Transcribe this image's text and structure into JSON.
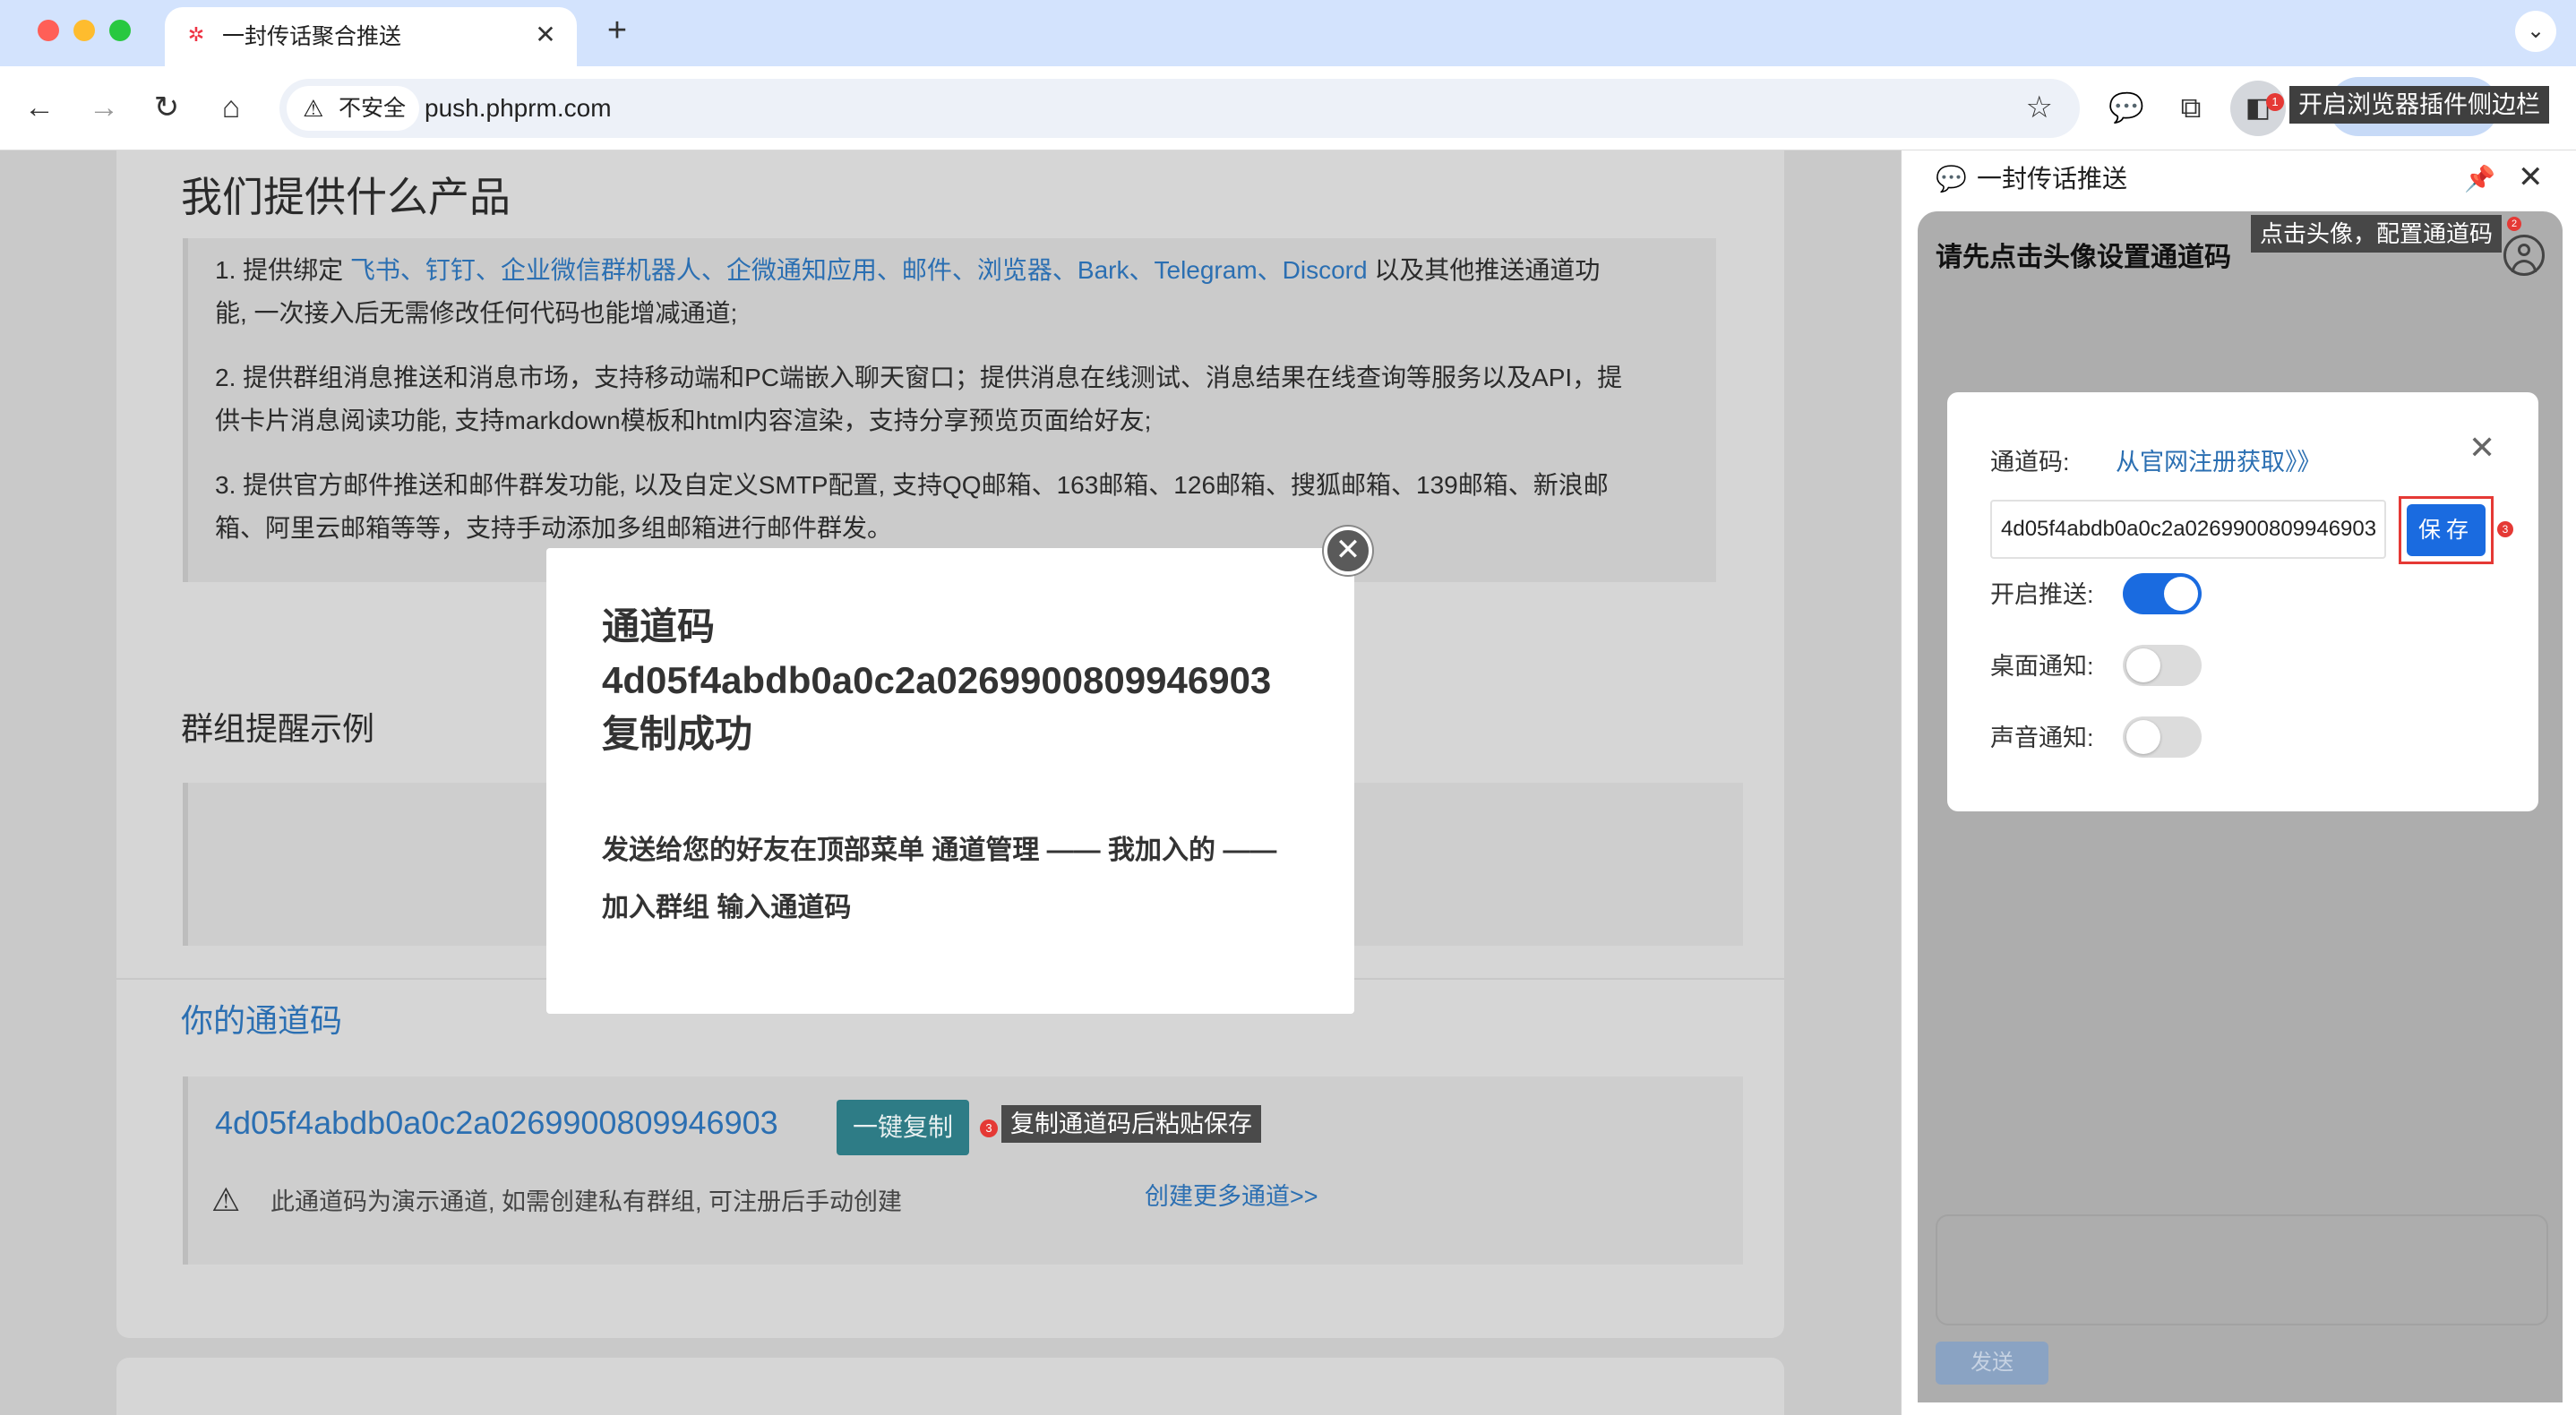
{
  "browser": {
    "tab_title": "一封传话聚合推送",
    "tab_close": "✕",
    "new_tab": "+",
    "security_label": "不安全",
    "url": "push.phprm.com",
    "sidebar_hint": "开启浏览器插件侧边栏",
    "sidebar_badge": "1",
    "icons": [
      "back-icon",
      "forward-icon",
      "reload-icon",
      "home-icon",
      "star-icon",
      "chat-icon",
      "extensions-icon",
      "sidebar-icon"
    ]
  },
  "page": {
    "products": {
      "heading": "我们提供什么产品",
      "p1_prefix": "1. 提供绑定 ",
      "p1_links": "飞书、钉钉、企业微信群机器人、企微通知应用、邮件、浏览器、Bark、Telegram、Discord",
      "p1_suffix": " 以及其他推送通道功能, 一次接入后无需修改任何代码也能增减通道;",
      "p2": "2. 提供群组消息推送和消息市场，支持移动端和PC端嵌入聊天窗口；提供消息在线测试、消息结果在线查询等服务以及API，提供卡片消息阅读功能, 支持markdown模板和html内容渲染，支持分享预览页面给好友;",
      "p3": "3. 提供官方邮件推送和邮件群发功能, 以及自定义SMTP配置, 支持QQ邮箱、163邮箱、126邮箱、搜狐邮箱、139邮箱、新浪邮箱、阿里云邮箱等等，支持手动添加多组邮箱进行邮件群发。"
    },
    "group_demo": {
      "heading": "群组提醒示例"
    },
    "channel": {
      "heading": "你的通道码",
      "code": "4d05f4abdb0a0c2a0269900809946903",
      "copy_button": "一键复制",
      "copy_badge": "3",
      "copy_hint": "复制通道码后粘贴保存",
      "warning": "此通道码为演示通道, 如需创建私有群组, 可注册后手动创建",
      "more_link": "创建更多通道>>"
    }
  },
  "modal": {
    "title_line1": "通道码",
    "title_line2": "4d05f4abdb0a0c2a0269900809946903",
    "title_line3": "复制成功",
    "body": "发送给您的好友在顶部菜单 通道管理 —— 我加入的 —— 加入群组 输入通道码",
    "close": "✕"
  },
  "sidepanel": {
    "title": "一封传话推送",
    "prompt": "请先点击头像设置通道码",
    "avatar_hint": "点击头像，配置通道码",
    "avatar_badge": "2",
    "send_button": "发送",
    "settings": {
      "channel_label": "通道码:",
      "register_link": "从官网注册获取》》",
      "channel_value": "4d05f4abdb0a0c2a0269900809946903",
      "save_button": "保存",
      "save_badge": "3",
      "enable_push_label": "开启推送:",
      "enable_push": true,
      "desktop_notify_label": "桌面通知:",
      "desktop_notify": false,
      "sound_notify_label": "声音通知:",
      "sound_notify": false
    }
  },
  "colors": {
    "accent": "#1a6be0",
    "link": "#2b6fb2",
    "copy_button": "#2e7c86",
    "badge": "#e53935"
  }
}
